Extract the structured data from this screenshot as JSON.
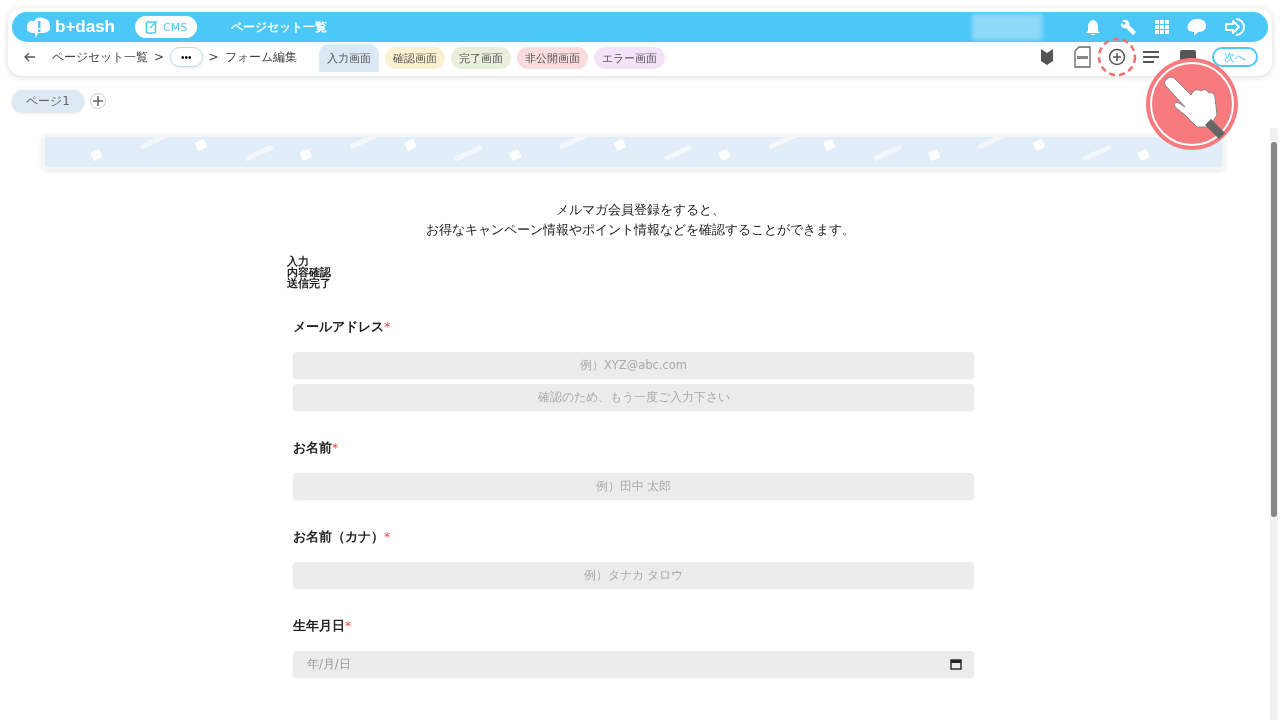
{
  "topbar": {
    "logo": "b+dash",
    "app_badge": "CMS",
    "title": "ページセット一覧"
  },
  "breadcrumb": {
    "items": [
      {
        "label": "ページセット一覧"
      },
      {
        "label": "•••"
      },
      {
        "label": "フォーム編集"
      }
    ],
    "separator": ">"
  },
  "screen_tabs": [
    {
      "label": "入力画面",
      "selected": true,
      "color": "#dce8f4"
    },
    {
      "label": "確認画面",
      "selected": false,
      "color": "#fbf0cf"
    },
    {
      "label": "完了画面",
      "selected": false,
      "color": "#e8f0dc"
    },
    {
      "label": "非公開画面",
      "selected": false,
      "color": "#fbdcdc"
    },
    {
      "label": "エラー画面",
      "selected": false,
      "color": "#f3e3f9"
    }
  ],
  "next_button": "次へ",
  "page_tabs": [
    {
      "label": "ページ1",
      "selected": true
    }
  ],
  "header_banner": {
    "kind": "picture"
  },
  "intro": [
    "メルマガ会員登録をすると、",
    "お得なキャンペーン情報やポイント情報などを確認することができます。"
  ],
  "steps": [
    "入力",
    "内容確認",
    "送信完了"
  ],
  "fields": [
    {
      "label": "メールアドレス",
      "required_mark": "*",
      "inputs": [
        {
          "placeholder": "例）XYZ@abc.com"
        },
        {
          "placeholder": "確認のため、もう一度ご入力下さい"
        }
      ]
    },
    {
      "label": "お名前",
      "required_mark": "*",
      "inputs": [
        {
          "placeholder": "例）田中 太郎"
        }
      ]
    },
    {
      "label": "お名前（カナ）",
      "required_mark": "*",
      "inputs": [
        {
          "placeholder": "例）タナカ タロウ"
        }
      ]
    },
    {
      "label": "生年月日",
      "required_mark": "*",
      "inputs": [
        {
          "placeholder": "年/月/日",
          "kind": "date"
        }
      ]
    }
  ]
}
